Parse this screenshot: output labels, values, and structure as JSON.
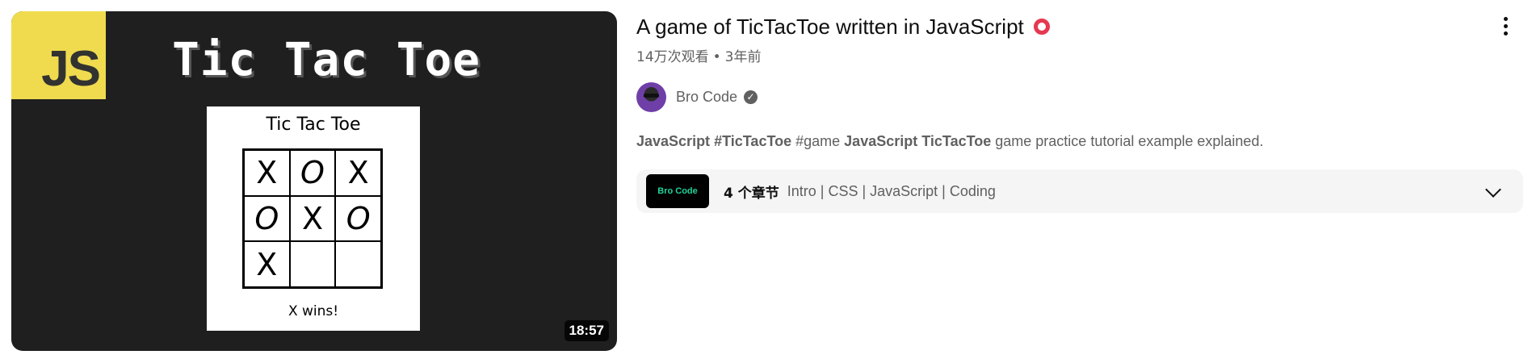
{
  "video": {
    "thumbnail": {
      "badge": "JS",
      "heading": "Tic Tac Toe",
      "card_title": "Tic Tac Toe",
      "board": [
        "X",
        "O",
        "X",
        "O",
        "X",
        "O",
        "X",
        "",
        ""
      ],
      "status": "X wins!",
      "duration": "18:57"
    },
    "title": "A game of TicTacToe written in JavaScript",
    "title_emoji": "hollow-red-circle-icon",
    "views": "14万次观看",
    "age": "3年前",
    "separator": "•",
    "channel": {
      "name": "Bro Code",
      "verified": true
    },
    "description": {
      "parts": [
        {
          "text": "JavaScript",
          "bold": true
        },
        {
          "text": " ",
          "bold": false
        },
        {
          "text": "#TicTacToe",
          "bold": true
        },
        {
          "text": " #game ",
          "bold": false
        },
        {
          "text": "JavaScript TicTacToe",
          "bold": true
        },
        {
          "text": " game practice tutorial example explained.",
          "bold": false
        }
      ]
    },
    "chapters": {
      "thumb_label": "Bro Code",
      "count_label": "4 个章节",
      "list": "Intro | CSS | JavaScript | Coding"
    }
  },
  "colors": {
    "accent_ring": "#e53950",
    "js_yellow": "#f0db4f",
    "thumb_bg": "#1f1f1f",
    "meta_gray": "#606060"
  }
}
